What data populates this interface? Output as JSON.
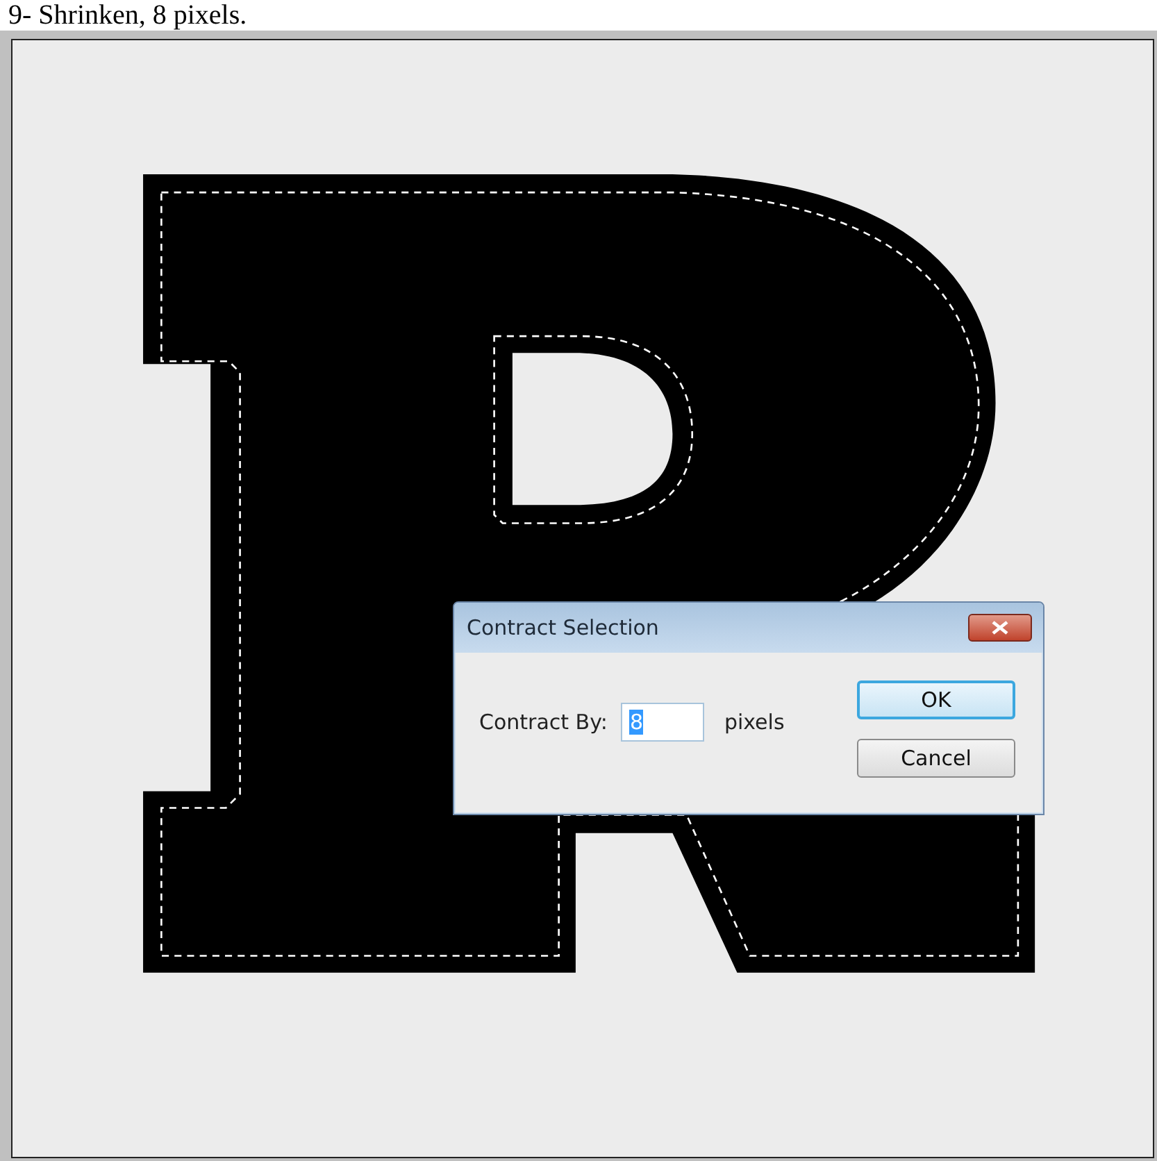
{
  "heading": "9- Shrinken, 8 pixels.",
  "dialog": {
    "title": "Contract Selection",
    "field_label": "Contract By:",
    "value": "8",
    "value_selected": true,
    "unit": "pixels",
    "buttons": [
      {
        "label": "OK",
        "default": true
      },
      {
        "label": "Cancel",
        "default": false
      }
    ]
  }
}
